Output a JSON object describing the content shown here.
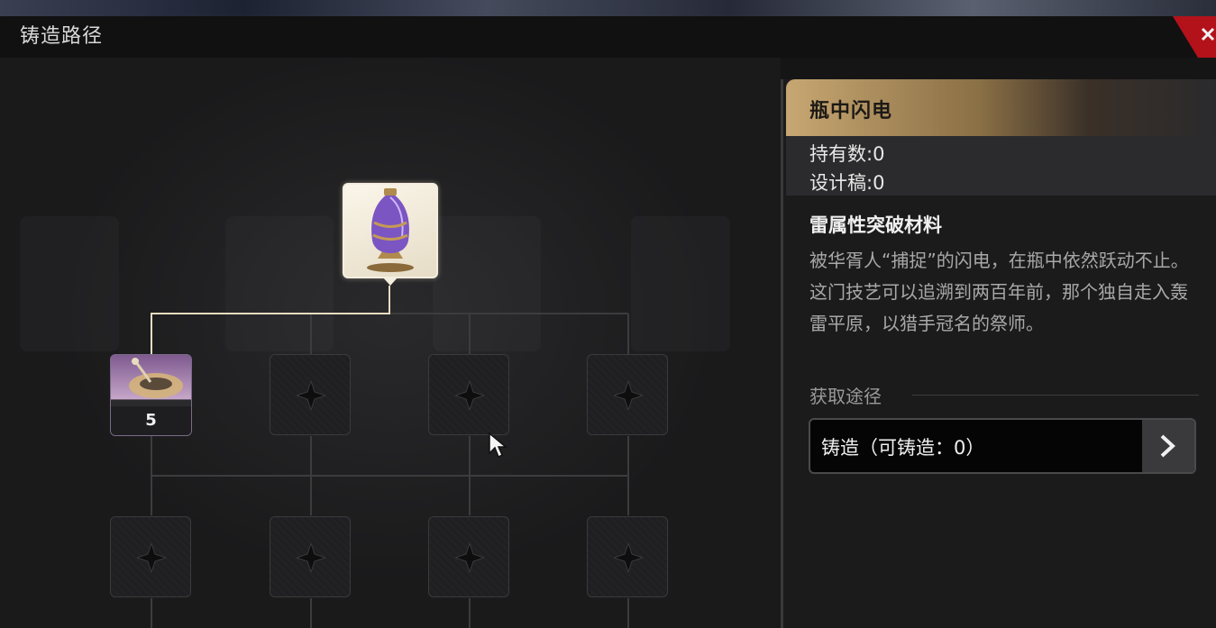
{
  "header": {
    "title": "铸造路径",
    "close_icon": "close-icon"
  },
  "tree": {
    "top_item_icon": "lightning-bottle-icon",
    "material_node": {
      "icon": "material-icon",
      "count": "5"
    },
    "empty_slot_icon": "star-placeholder-icon"
  },
  "detail": {
    "name": "瓶中闪电",
    "owned": "持有数:0",
    "blueprints": "设计稿:0",
    "category": "雷属性突破材料",
    "description": "被华胥人“捕捉”的闪电，在瓶中依然跃动不止。这门技艺可以追溯到两百年前，那个独自走入轰雷平原，以猎手冠名的祭师。",
    "acquire_label": "获取途径",
    "forge_button_label": "铸造（可铸造：0）",
    "forge_arrow_icon": "chevron-right-icon"
  },
  "colors": {
    "accent_gold": "#c7a772",
    "close_red": "#b3121a",
    "line_gold": "#e8dcc0"
  }
}
